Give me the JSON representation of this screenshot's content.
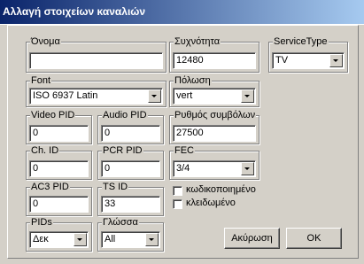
{
  "window": {
    "title": "Αλλαγή στοιχείων καναλιών"
  },
  "groups": {
    "name": {
      "label": "Όνομα",
      "value": ""
    },
    "frequency": {
      "label": "Συχνότητα",
      "value": "12480"
    },
    "service_type": {
      "label": "ServiceType",
      "value": "TV"
    },
    "font": {
      "label": "Font",
      "value": "ISO 6937 Latin"
    },
    "polarization": {
      "label": "Πόλωση",
      "value": "vert"
    },
    "video_pid": {
      "label": "Video PID",
      "value": "0"
    },
    "audio_pid": {
      "label": "Audio PID",
      "value": "0"
    },
    "symbol_rate": {
      "label": "Ρυθμός συμβόλων",
      "value": "27500"
    },
    "ch_id": {
      "label": "Ch. ID",
      "value": "0"
    },
    "pcr_pid": {
      "label": "PCR PID",
      "value": "0"
    },
    "fec": {
      "label": "FEC",
      "value": "3/4"
    },
    "ac3_pid": {
      "label": "AC3 PID",
      "value": "0"
    },
    "ts_id": {
      "label": "TS ID",
      "value": "33"
    },
    "pids": {
      "label": "PIDs",
      "value": "Δεκ"
    },
    "language": {
      "label": "Γλώσσα",
      "value": "All"
    }
  },
  "checkboxes": {
    "encrypted": {
      "label": "κωδικοποιημένο",
      "checked": false
    },
    "locked": {
      "label": "κλειδωμένο",
      "checked": false
    }
  },
  "buttons": {
    "cancel": "Ακύρωση",
    "ok": "OK"
  }
}
